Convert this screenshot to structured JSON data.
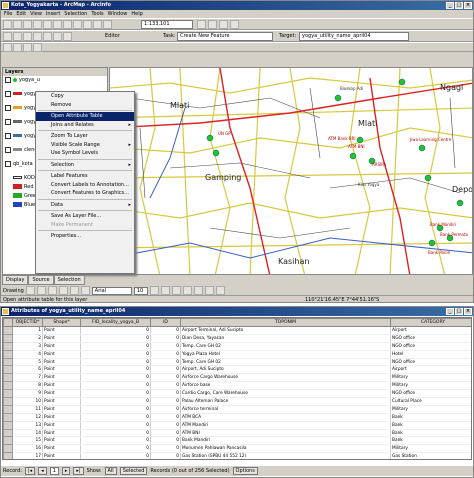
{
  "arcmap": {
    "title": "Kota_Yogyakarta - ArcMap - ArcInfo",
    "menu": [
      "File",
      "Edit",
      "View",
      "Insert",
      "Selection",
      "Tools",
      "Window",
      "Help"
    ],
    "scale": "1:133,101",
    "editor_label": "Editor",
    "task_label": "Task:",
    "task_value": "Create New Feature",
    "target_label": "Target:",
    "target_value": "yogya_utility_name_april04"
  },
  "toc": {
    "header": "Layers",
    "layers": [
      {
        "label": "yogya_u",
        "checked": true,
        "color": "#22c22e"
      },
      {
        "label": "yogya_r",
        "checked": true,
        "color": "#cc2222"
      },
      {
        "label": "yogya_s",
        "checked": true,
        "color": "#e0a020"
      },
      {
        "label": "yogya_j",
        "checked": true,
        "color": "#666666"
      },
      {
        "label": "yogya_b",
        "checked": true,
        "color": "#3a6ea5"
      },
      {
        "label": "clene_y",
        "checked": true,
        "color": "#888888"
      },
      {
        "label": "qb_kota",
        "checked": true,
        "color": "#cccccc"
      },
      {
        "label": "KODE",
        "checked": false,
        "color": "#ffffff"
      },
      {
        "label": "Red",
        "checked": false,
        "color": "#cc2222"
      },
      {
        "label": "Gree",
        "checked": false,
        "color": "#22aa22"
      },
      {
        "label": "Blue",
        "checked": false,
        "color": "#2244cc"
      }
    ]
  },
  "context_menu": [
    {
      "label": "Copy",
      "state": "normal",
      "arrow": false
    },
    {
      "label": "Remove",
      "state": "normal",
      "arrow": false
    },
    {
      "label": "Open Attribute Table",
      "state": "selected",
      "arrow": false
    },
    {
      "label": "Joins and Relates",
      "state": "normal",
      "arrow": true
    },
    {
      "label": "Zoom To Layer",
      "state": "normal",
      "arrow": false
    },
    {
      "label": "Visible Scale Range",
      "state": "normal",
      "arrow": true
    },
    {
      "label": "Use Symbol Levels",
      "state": "normal",
      "arrow": false
    },
    {
      "label": "Selection",
      "state": "normal",
      "arrow": true
    },
    {
      "label": "Label Features",
      "state": "normal",
      "arrow": false
    },
    {
      "label": "Convert Labels to Annotation...",
      "state": "normal",
      "arrow": false
    },
    {
      "label": "Convert Features to Graphics...",
      "state": "normal",
      "arrow": false
    },
    {
      "label": "Data",
      "state": "normal",
      "arrow": true
    },
    {
      "label": "Save As Layer File...",
      "state": "normal",
      "arrow": false
    },
    {
      "label": "Make Permanent",
      "state": "disabled",
      "arrow": false
    },
    {
      "label": "Properties...",
      "state": "normal",
      "arrow": false
    }
  ],
  "map_labels": {
    "place_mlati_w": "Mlati",
    "place_mlati_e": "Mlati",
    "place_gamping": "Gamping",
    "place_kasihan": "Kasihan",
    "place_ngaglik": "Ngagl",
    "place_depok": "Depok",
    "poi_1": "ATM Bank BRI",
    "poi_2": "ATM BNI",
    "poi_3": "ARSIPA",
    "poi_4": "Jiwa Learning Centre",
    "poi_5": "Bank Mandiri",
    "poi_6": "Bank Permata",
    "poi_7": "Bank Panin",
    "poi_8": "UN GP",
    "poi_9": "Kios Yogya",
    "poi_10": "Bioskop Adi"
  },
  "tabs": [
    "Display",
    "Source",
    "Selection"
  ],
  "drawing_label": "Drawing",
  "font_value": "Arial",
  "font_size": "10",
  "status": {
    "message": "Open attribute table for this layer",
    "coord": "110°21'16.45\"E 7°44'51.16\"S",
    "unit": ""
  },
  "attr_table": {
    "title": "Attributes of yogya_utility_name_april04",
    "columns": [
      "OBJECTID*",
      "Shape*",
      "FID_locality_yogya_B",
      "ID",
      "TOPONIM",
      "CATEGORY"
    ],
    "rows": [
      [
        "1",
        "Point",
        "0",
        "0",
        "Airport Terminal, Adi Sucipto",
        "Airport"
      ],
      [
        "2",
        "Point",
        "0",
        "0",
        "Dian Desa, Yayasan",
        "NGO office"
      ],
      [
        "3",
        "Point",
        "0",
        "0",
        "Temp. Care GH 02",
        "NGO office"
      ],
      [
        "4",
        "Point",
        "0",
        "0",
        "Yogya Plaza Hotel",
        "Hotel"
      ],
      [
        "5",
        "Point",
        "0",
        "0",
        "Temp. Care GH 02",
        "NGO office"
      ],
      [
        "6",
        "Point",
        "0",
        "0",
        "Airport, Adi Sucipto",
        "Airport"
      ],
      [
        "7",
        "Point",
        "0",
        "0",
        "Airforce Cargo Warehouse",
        "Military"
      ],
      [
        "8",
        "Point",
        "0",
        "0",
        "Airforce base",
        "Military"
      ],
      [
        "9",
        "Point",
        "0",
        "0",
        "Cardio Cargo, Care Warehouse",
        "NGO office"
      ],
      [
        "10",
        "Point",
        "0",
        "0",
        "Palau Alteman Palace",
        "Cultural Place"
      ],
      [
        "11",
        "Point",
        "0",
        "0",
        "Airforce terminal",
        "Military"
      ],
      [
        "12",
        "Point",
        "0",
        "0",
        "ATM BCA",
        "Bank"
      ],
      [
        "13",
        "Point",
        "0",
        "0",
        "ATM Mandiri",
        "Bank"
      ],
      [
        "14",
        "Point",
        "0",
        "0",
        "ATM BNI",
        "Bank"
      ],
      [
        "15",
        "Point",
        "0",
        "0",
        "Bank Mandiri",
        "Bank"
      ],
      [
        "16",
        "Point",
        "0",
        "0",
        "Monumen Pahlawan Pancasila",
        "Military"
      ],
      [
        "17",
        "Point",
        "0",
        "0",
        "Gas Station (SPBU 44 552 12)",
        "Gas Station"
      ],
      [
        "18",
        "Point",
        "0",
        "0",
        "Gelanggang Olah Raga / Emergency Clinic",
        "Public Facility"
      ],
      [
        "19",
        "Point",
        "0",
        "0",
        "Universitas Negeri Yogya",
        "University"
      ]
    ],
    "record_label": "Record:",
    "record_value": "1",
    "show_label": "Show:",
    "all_label": "All",
    "selected_label": "Selected",
    "records_text": "Records (0 out of 256 Selected)",
    "options_label": "Options"
  }
}
